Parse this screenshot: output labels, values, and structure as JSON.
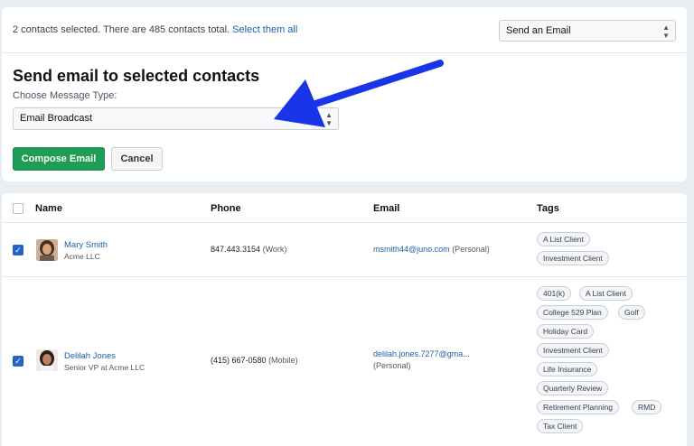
{
  "selection_bar": {
    "text": "2 contacts selected. There are 485 contacts total.",
    "select_all_link": "Select them all",
    "action_select": {
      "value": "Send an Email"
    }
  },
  "panel": {
    "title": "Send email to selected contacts",
    "message_type_label": "Choose Message Type:",
    "message_type_select": {
      "value": "Email Broadcast"
    },
    "compose_button": "Compose Email",
    "cancel_button": "Cancel"
  },
  "table": {
    "headers": {
      "name": "Name",
      "phone": "Phone",
      "email": "Email",
      "tags": "Tags"
    },
    "rows": [
      {
        "checked": true,
        "name": "Mary Smith",
        "subtitle": "Acme LLC",
        "phone": "847.443.3154",
        "phone_type": "(Work)",
        "email": "msmith44@juno.com",
        "email_type": "(Personal)",
        "tags": [
          "A List Client",
          "Investment Client"
        ]
      },
      {
        "checked": true,
        "name": "Delilah Jones",
        "subtitle": "Senior VP at Acme LLC",
        "phone": "(415) 667-0580",
        "phone_type": "(Mobile)",
        "email": "delilah.jones.7277@gma...",
        "email_type": "(Personal)",
        "tags": [
          "401(k)",
          "A List Client",
          "College 529 Plan",
          "Golf",
          "Holiday Card",
          "Investment Client",
          "Life Insurance",
          "Quarterly Review",
          "Retirement Planning",
          "RMD",
          "Tax Client"
        ]
      }
    ]
  },
  "colors": {
    "page_background": "#e9eef2",
    "primary_button": "#1f9d57",
    "link": "#1d5fa8",
    "checkbox_checked": "#2563c9",
    "annotation_arrow": "#1836e8"
  },
  "icons": [
    "select-updown-icon",
    "checkmark-icon",
    "avatar-photo",
    "annotation-arrow"
  ]
}
